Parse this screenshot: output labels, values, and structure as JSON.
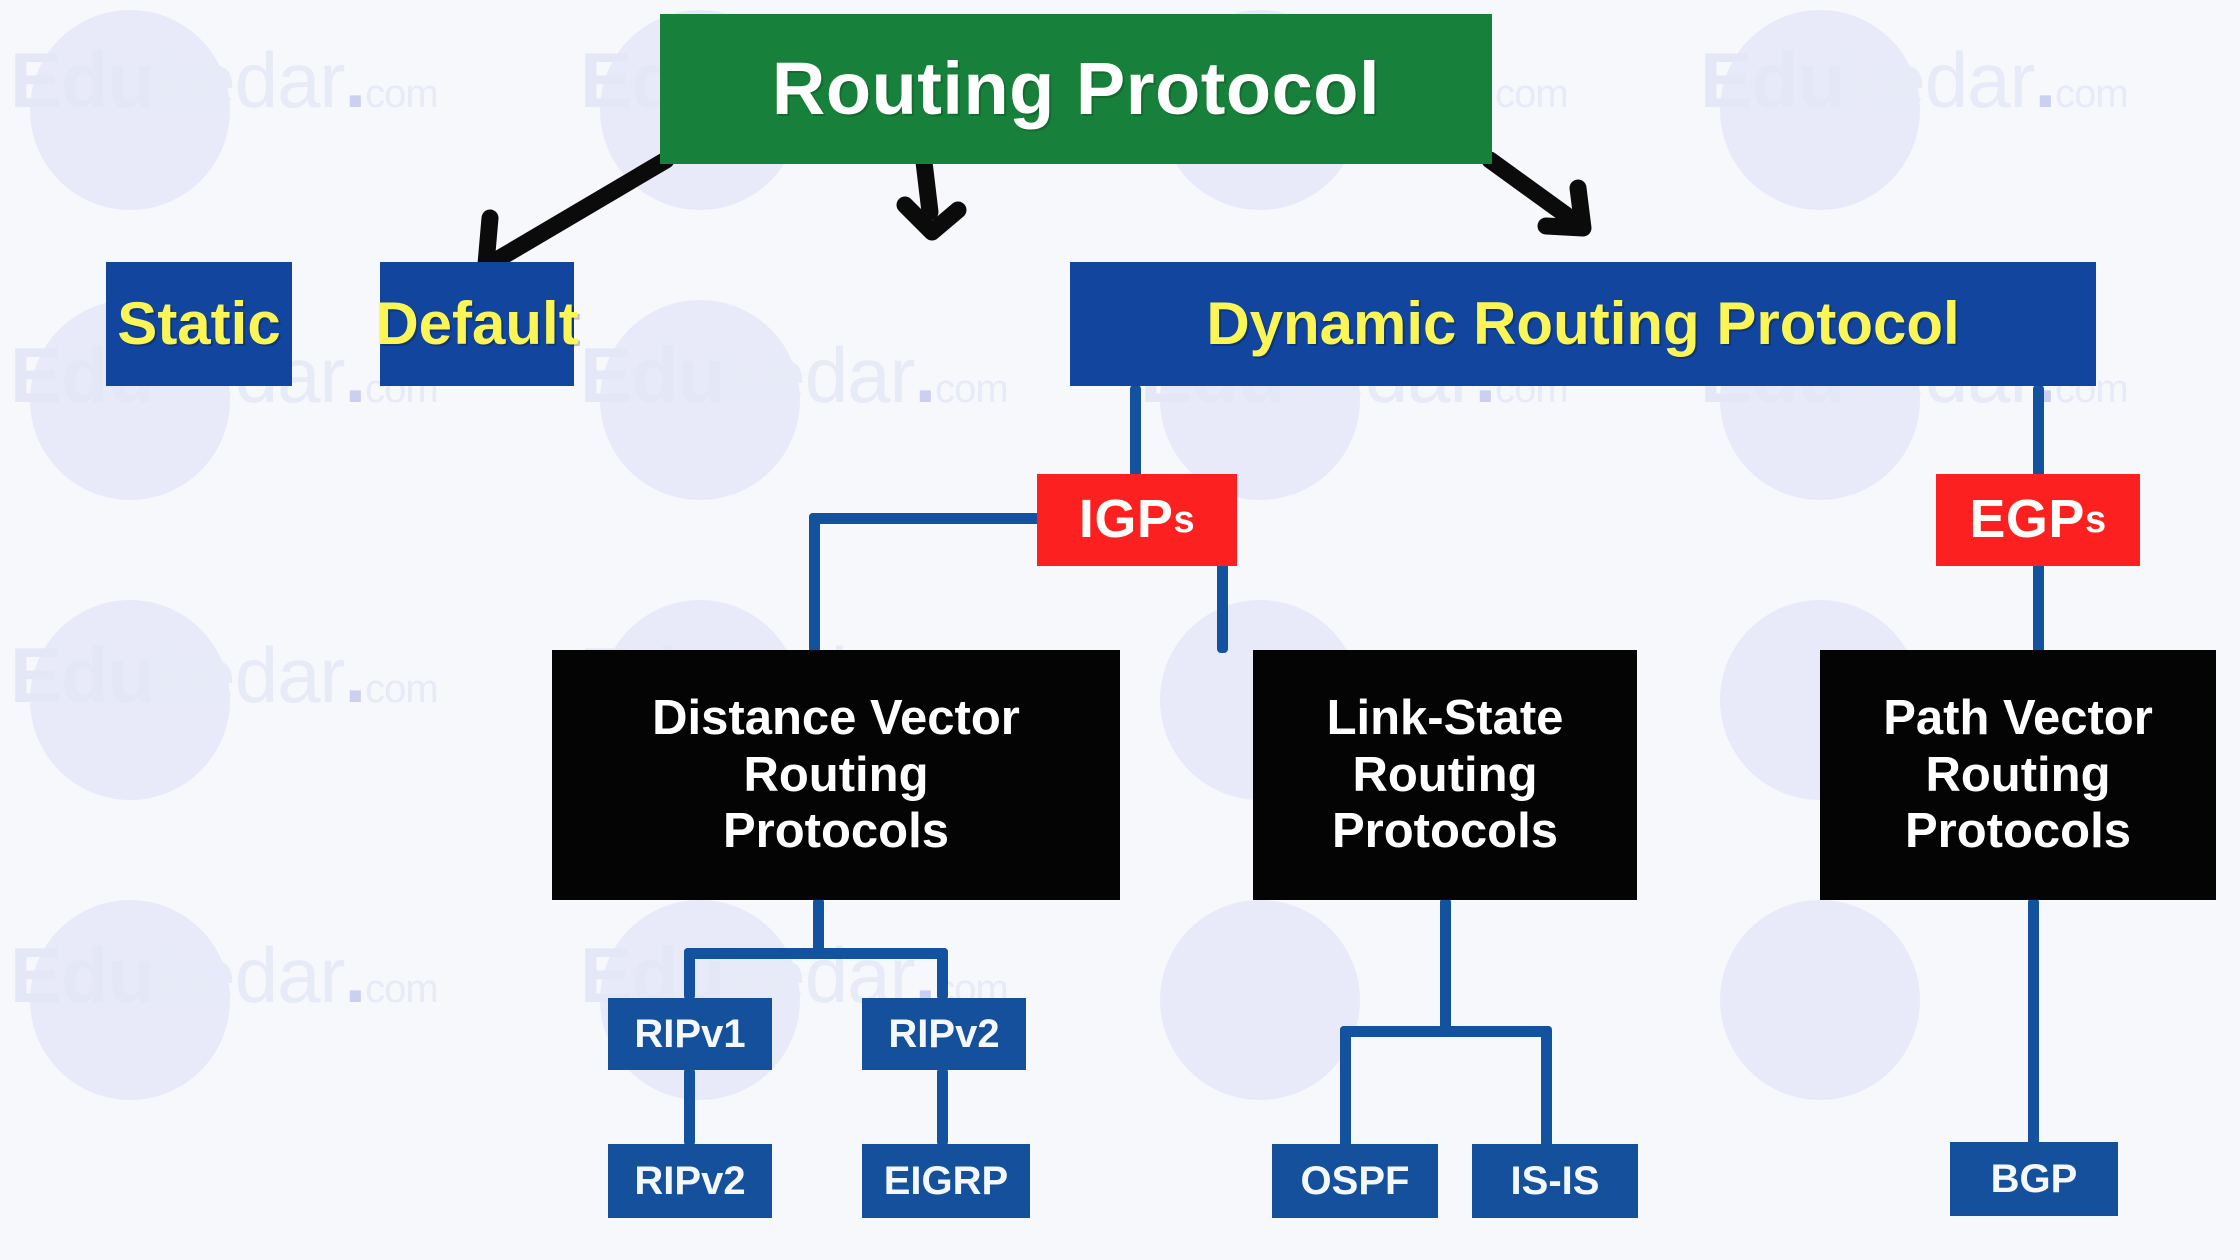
{
  "diagram": {
    "title": "Routing Protocol",
    "root": {
      "label": "Routing Protocol"
    },
    "level1": [
      {
        "label": "Static"
      },
      {
        "label": "Default"
      },
      {
        "label": "Dynamic Routing Protocol"
      }
    ],
    "gateways": [
      {
        "label_main": "IGP",
        "label_sub": "s",
        "full": "IGPs"
      },
      {
        "label_main": "EGP",
        "label_sub": "s",
        "full": "EGPs"
      }
    ],
    "families": [
      {
        "line1": "Distance Vector",
        "line2": "Routing",
        "line3": "Protocols"
      },
      {
        "line1": "Link-State",
        "line2": "Routing",
        "line3": "Protocols"
      },
      {
        "line1": "Path Vector",
        "line2": "Routing",
        "line3": "Protocols"
      }
    ],
    "leaves": {
      "distance_vector_upper": [
        {
          "label": "RIPv1"
        },
        {
          "label": "RIPv2"
        }
      ],
      "distance_vector_lower": [
        {
          "label": "RIPv2"
        },
        {
          "label": "EIGRP"
        }
      ],
      "link_state": [
        {
          "label": "OSPF"
        },
        {
          "label": "IS-IS"
        }
      ],
      "path_vector": [
        {
          "label": "BGP"
        }
      ]
    },
    "colors": {
      "root_green": "#17803a",
      "node_blue": "#11459e",
      "gateway_red": "#fc2020",
      "family_black": "#040404",
      "leaf_blue": "#14509c",
      "connector_blue": "#13529f",
      "yellow_text": "#fbf655",
      "background": "#f7f8fc"
    }
  },
  "watermarks": [
    {
      "bold": "Edu",
      "light": "kedar",
      "dot": ".",
      "com": "com"
    },
    {
      "bold": "Edu",
      "light": "kedar",
      "dot": ".",
      "com": "com"
    },
    {
      "bold": "Edu",
      "light": "kedar",
      "dot": ".",
      "com": "com"
    },
    {
      "bold": "Edu",
      "light": "kedar",
      "dot": ".",
      "com": "com"
    },
    {
      "bold": "Edu",
      "light": "kedar",
      "dot": ".",
      "com": "com"
    },
    {
      "bold": "Edu",
      "light": "kedar",
      "dot": ".",
      "com": "com"
    },
    {
      "bold": "Edu",
      "light": "kedar",
      "dot": ".",
      "com": "com"
    },
    {
      "bold": "Edu",
      "light": "kedar",
      "dot": ".",
      "com": "com"
    },
    {
      "bold": "Edu",
      "light": "kedar",
      "dot": ".",
      "com": "com"
    },
    {
      "bold": "Edu",
      "light": "kedar",
      "dot": ".",
      "com": "com"
    },
    {
      "bold": "Edu",
      "light": "kedar",
      "dot": ".",
      "com": "com"
    },
    {
      "bold": "Edu",
      "light": "kedar",
      "dot": ".",
      "com": "com"
    }
  ]
}
